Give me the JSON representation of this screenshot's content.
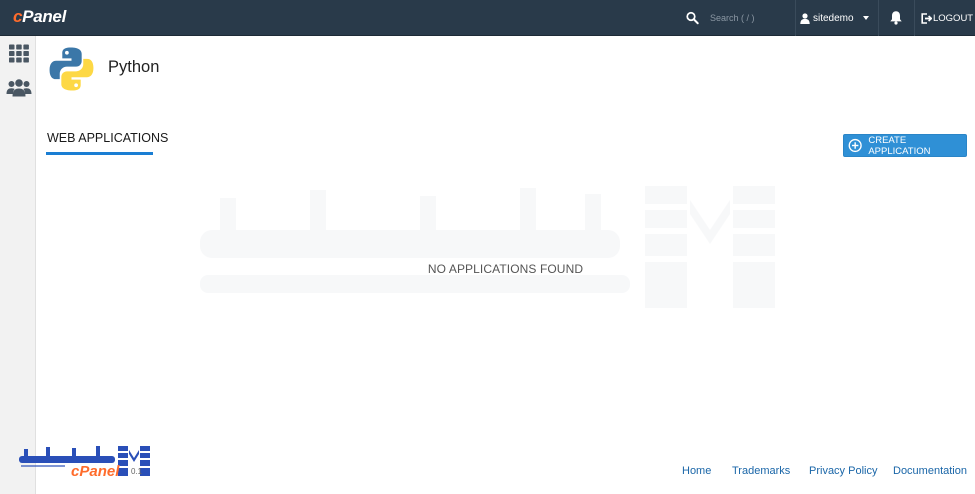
{
  "header": {
    "brand": "cPanel",
    "search_placeholder": "Search ( / )",
    "username": "sitedemo",
    "logout_label": "LOGOUT"
  },
  "page": {
    "title": "Python",
    "tab_label": "WEB APPLICATIONS",
    "create_button_label": "CREATE APPLICATION",
    "empty_message": "NO APPLICATIONS FOUND"
  },
  "footer": {
    "version": "0.1",
    "links": [
      "Home",
      "Trademarks",
      "Privacy Policy",
      "Documentation"
    ]
  },
  "colors": {
    "topbar": "#293a4a",
    "accent": "#1a7ed3",
    "button": "#2f90d6",
    "link": "#1a66a8"
  },
  "icons": {
    "sidebar": [
      "grid-icon",
      "users-icon"
    ],
    "header": [
      "search-icon",
      "user-icon",
      "bell-icon",
      "logout-icon"
    ],
    "page": "python-logo-icon",
    "button": "plus-circle-icon"
  }
}
